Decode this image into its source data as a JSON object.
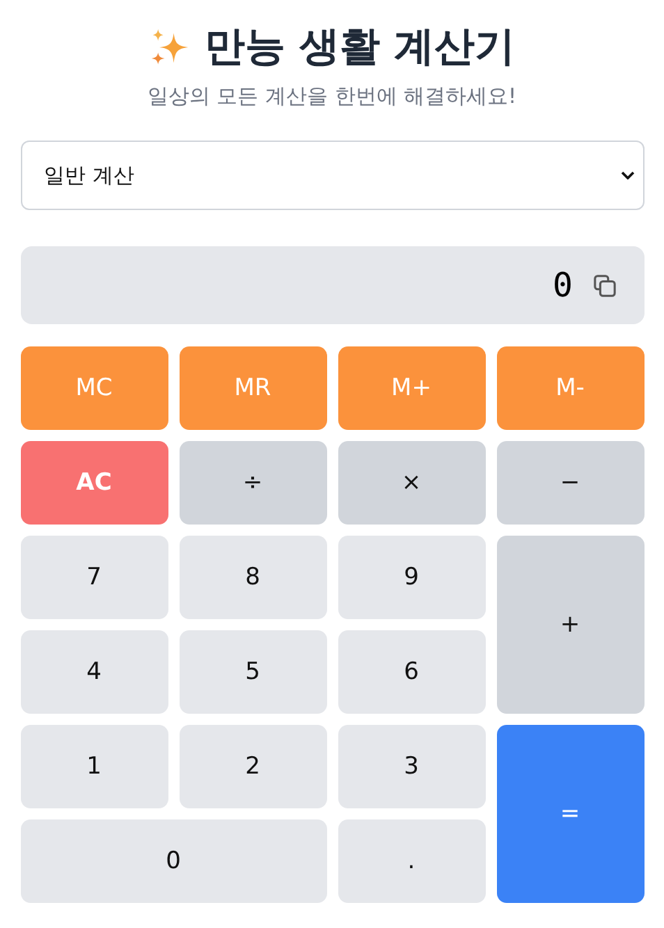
{
  "header": {
    "title": "만능 생활 계산기",
    "subtitle": "일상의 모든 계산을 한번에 해결하세요!"
  },
  "mode_select": {
    "value": "일반 계산"
  },
  "display": {
    "value": "0"
  },
  "keys": [
    {
      "label": "MC",
      "kind": "memory"
    },
    {
      "label": "MR",
      "kind": "memory"
    },
    {
      "label": "M+",
      "kind": "memory"
    },
    {
      "label": "M-",
      "kind": "memory"
    },
    {
      "label": "AC",
      "kind": "clear"
    },
    {
      "label": "÷",
      "kind": "operator"
    },
    {
      "label": "×",
      "kind": "operator"
    },
    {
      "label": "−",
      "kind": "operator"
    },
    {
      "label": "7",
      "kind": "digit"
    },
    {
      "label": "8",
      "kind": "digit"
    },
    {
      "label": "9",
      "kind": "digit"
    },
    {
      "label": "+",
      "kind": "operator"
    },
    {
      "label": "4",
      "kind": "digit"
    },
    {
      "label": "5",
      "kind": "digit"
    },
    {
      "label": "6",
      "kind": "digit"
    },
    {
      "label": "1",
      "kind": "digit"
    },
    {
      "label": "2",
      "kind": "digit"
    },
    {
      "label": "3",
      "kind": "digit"
    },
    {
      "label": "=",
      "kind": "equals"
    },
    {
      "label": "0",
      "kind": "digit"
    },
    {
      "label": ".",
      "kind": "digit"
    }
  ]
}
